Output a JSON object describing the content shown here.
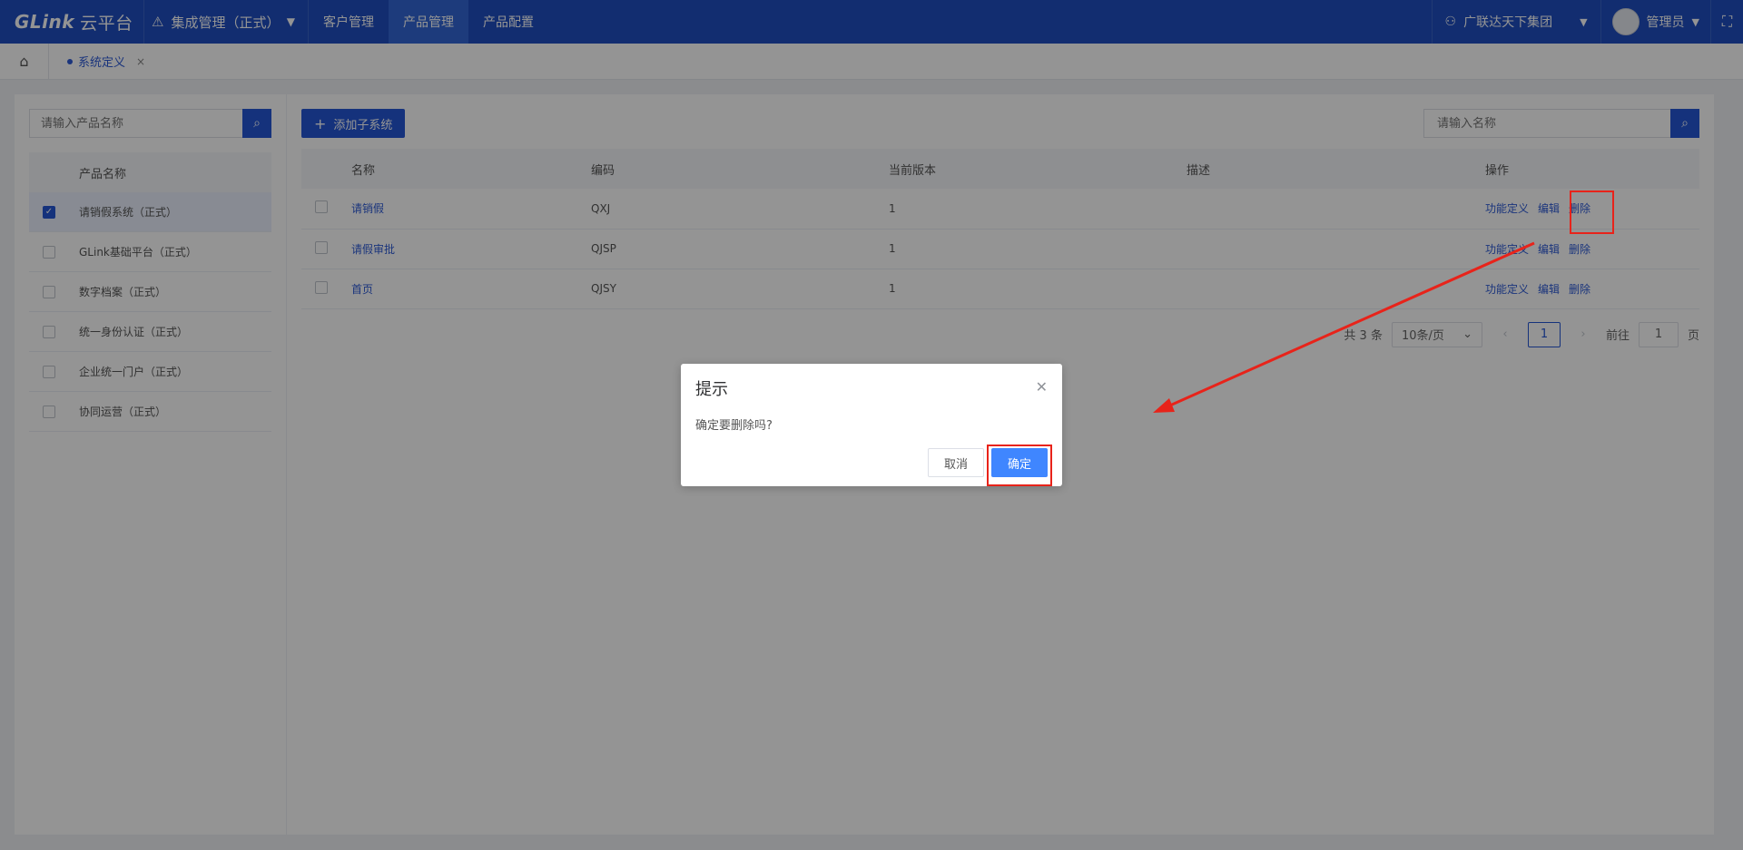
{
  "header": {
    "logo_text": "GLink",
    "logo_cn": "云平台",
    "system_switch": "集成管理（正式）",
    "nav": [
      {
        "label": "客户管理"
      },
      {
        "label": "产品管理"
      },
      {
        "label": "产品配置"
      }
    ],
    "org": "广联达天下集团",
    "user": "管理员"
  },
  "tabs": [
    {
      "label": "系统定义"
    }
  ],
  "left_panel": {
    "search_placeholder": "请输入产品名称",
    "column_header": "产品名称",
    "products": [
      {
        "label": "请销假系统（正式）",
        "checked": true
      },
      {
        "label": "GLink基础平台（正式）",
        "checked": false
      },
      {
        "label": "数字档案（正式）",
        "checked": false
      },
      {
        "label": "统一身份认证（正式）",
        "checked": false
      },
      {
        "label": "企业统一门户（正式）",
        "checked": false
      },
      {
        "label": "协同运营（正式）",
        "checked": false
      }
    ]
  },
  "main": {
    "add_button": "添加子系统",
    "search_placeholder": "请输入名称",
    "columns": {
      "name": "名称",
      "code": "编码",
      "version": "当前版本",
      "desc": "描述",
      "ops": "操作"
    },
    "rows": [
      {
        "name": "请销假",
        "code": "QXJ",
        "version": "1",
        "desc": ""
      },
      {
        "name": "请假审批",
        "code": "QJSP",
        "version": "1",
        "desc": ""
      },
      {
        "name": "首页",
        "code": "QJSY",
        "version": "1",
        "desc": ""
      }
    ],
    "ops": {
      "define": "功能定义",
      "edit": "编辑",
      "delete": "删除"
    },
    "pager": {
      "total": "共 3 条",
      "page_size": "10条/页",
      "current_page": "1",
      "goto_label": "前往",
      "goto_value": "1",
      "page_unit": "页"
    }
  },
  "dialog": {
    "title": "提示",
    "message": "确定要删除吗?",
    "cancel": "取消",
    "confirm": "确定"
  },
  "colors": {
    "primary": "#1f4fc1",
    "accent": "#2557d6",
    "confirm": "#3f86ff",
    "annotation": "#e8231a"
  }
}
